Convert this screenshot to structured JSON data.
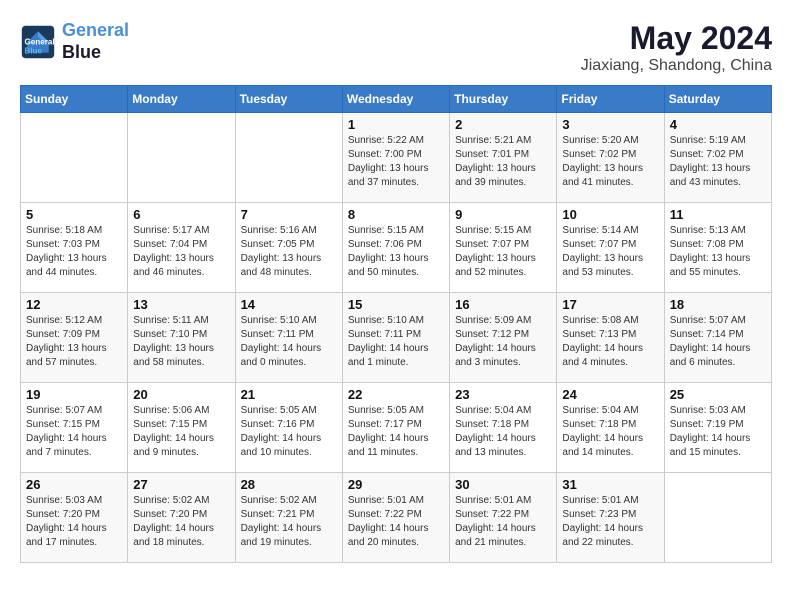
{
  "header": {
    "logo_line1": "General",
    "logo_line2": "Blue",
    "month": "May 2024",
    "location": "Jiaxiang, Shandong, China"
  },
  "weekdays": [
    "Sunday",
    "Monday",
    "Tuesday",
    "Wednesday",
    "Thursday",
    "Friday",
    "Saturday"
  ],
  "weeks": [
    [
      {
        "day": "",
        "info": ""
      },
      {
        "day": "",
        "info": ""
      },
      {
        "day": "",
        "info": ""
      },
      {
        "day": "1",
        "info": "Sunrise: 5:22 AM\nSunset: 7:00 PM\nDaylight: 13 hours and 37 minutes."
      },
      {
        "day": "2",
        "info": "Sunrise: 5:21 AM\nSunset: 7:01 PM\nDaylight: 13 hours and 39 minutes."
      },
      {
        "day": "3",
        "info": "Sunrise: 5:20 AM\nSunset: 7:02 PM\nDaylight: 13 hours and 41 minutes."
      },
      {
        "day": "4",
        "info": "Sunrise: 5:19 AM\nSunset: 7:02 PM\nDaylight: 13 hours and 43 minutes."
      }
    ],
    [
      {
        "day": "5",
        "info": "Sunrise: 5:18 AM\nSunset: 7:03 PM\nDaylight: 13 hours and 44 minutes."
      },
      {
        "day": "6",
        "info": "Sunrise: 5:17 AM\nSunset: 7:04 PM\nDaylight: 13 hours and 46 minutes."
      },
      {
        "day": "7",
        "info": "Sunrise: 5:16 AM\nSunset: 7:05 PM\nDaylight: 13 hours and 48 minutes."
      },
      {
        "day": "8",
        "info": "Sunrise: 5:15 AM\nSunset: 7:06 PM\nDaylight: 13 hours and 50 minutes."
      },
      {
        "day": "9",
        "info": "Sunrise: 5:15 AM\nSunset: 7:07 PM\nDaylight: 13 hours and 52 minutes."
      },
      {
        "day": "10",
        "info": "Sunrise: 5:14 AM\nSunset: 7:07 PM\nDaylight: 13 hours and 53 minutes."
      },
      {
        "day": "11",
        "info": "Sunrise: 5:13 AM\nSunset: 7:08 PM\nDaylight: 13 hours and 55 minutes."
      }
    ],
    [
      {
        "day": "12",
        "info": "Sunrise: 5:12 AM\nSunset: 7:09 PM\nDaylight: 13 hours and 57 minutes."
      },
      {
        "day": "13",
        "info": "Sunrise: 5:11 AM\nSunset: 7:10 PM\nDaylight: 13 hours and 58 minutes."
      },
      {
        "day": "14",
        "info": "Sunrise: 5:10 AM\nSunset: 7:11 PM\nDaylight: 14 hours and 0 minutes."
      },
      {
        "day": "15",
        "info": "Sunrise: 5:10 AM\nSunset: 7:11 PM\nDaylight: 14 hours and 1 minute."
      },
      {
        "day": "16",
        "info": "Sunrise: 5:09 AM\nSunset: 7:12 PM\nDaylight: 14 hours and 3 minutes."
      },
      {
        "day": "17",
        "info": "Sunrise: 5:08 AM\nSunset: 7:13 PM\nDaylight: 14 hours and 4 minutes."
      },
      {
        "day": "18",
        "info": "Sunrise: 5:07 AM\nSunset: 7:14 PM\nDaylight: 14 hours and 6 minutes."
      }
    ],
    [
      {
        "day": "19",
        "info": "Sunrise: 5:07 AM\nSunset: 7:15 PM\nDaylight: 14 hours and 7 minutes."
      },
      {
        "day": "20",
        "info": "Sunrise: 5:06 AM\nSunset: 7:15 PM\nDaylight: 14 hours and 9 minutes."
      },
      {
        "day": "21",
        "info": "Sunrise: 5:05 AM\nSunset: 7:16 PM\nDaylight: 14 hours and 10 minutes."
      },
      {
        "day": "22",
        "info": "Sunrise: 5:05 AM\nSunset: 7:17 PM\nDaylight: 14 hours and 11 minutes."
      },
      {
        "day": "23",
        "info": "Sunrise: 5:04 AM\nSunset: 7:18 PM\nDaylight: 14 hours and 13 minutes."
      },
      {
        "day": "24",
        "info": "Sunrise: 5:04 AM\nSunset: 7:18 PM\nDaylight: 14 hours and 14 minutes."
      },
      {
        "day": "25",
        "info": "Sunrise: 5:03 AM\nSunset: 7:19 PM\nDaylight: 14 hours and 15 minutes."
      }
    ],
    [
      {
        "day": "26",
        "info": "Sunrise: 5:03 AM\nSunset: 7:20 PM\nDaylight: 14 hours and 17 minutes."
      },
      {
        "day": "27",
        "info": "Sunrise: 5:02 AM\nSunset: 7:20 PM\nDaylight: 14 hours and 18 minutes."
      },
      {
        "day": "28",
        "info": "Sunrise: 5:02 AM\nSunset: 7:21 PM\nDaylight: 14 hours and 19 minutes."
      },
      {
        "day": "29",
        "info": "Sunrise: 5:01 AM\nSunset: 7:22 PM\nDaylight: 14 hours and 20 minutes."
      },
      {
        "day": "30",
        "info": "Sunrise: 5:01 AM\nSunset: 7:22 PM\nDaylight: 14 hours and 21 minutes."
      },
      {
        "day": "31",
        "info": "Sunrise: 5:01 AM\nSunset: 7:23 PM\nDaylight: 14 hours and 22 minutes."
      },
      {
        "day": "",
        "info": ""
      }
    ]
  ]
}
